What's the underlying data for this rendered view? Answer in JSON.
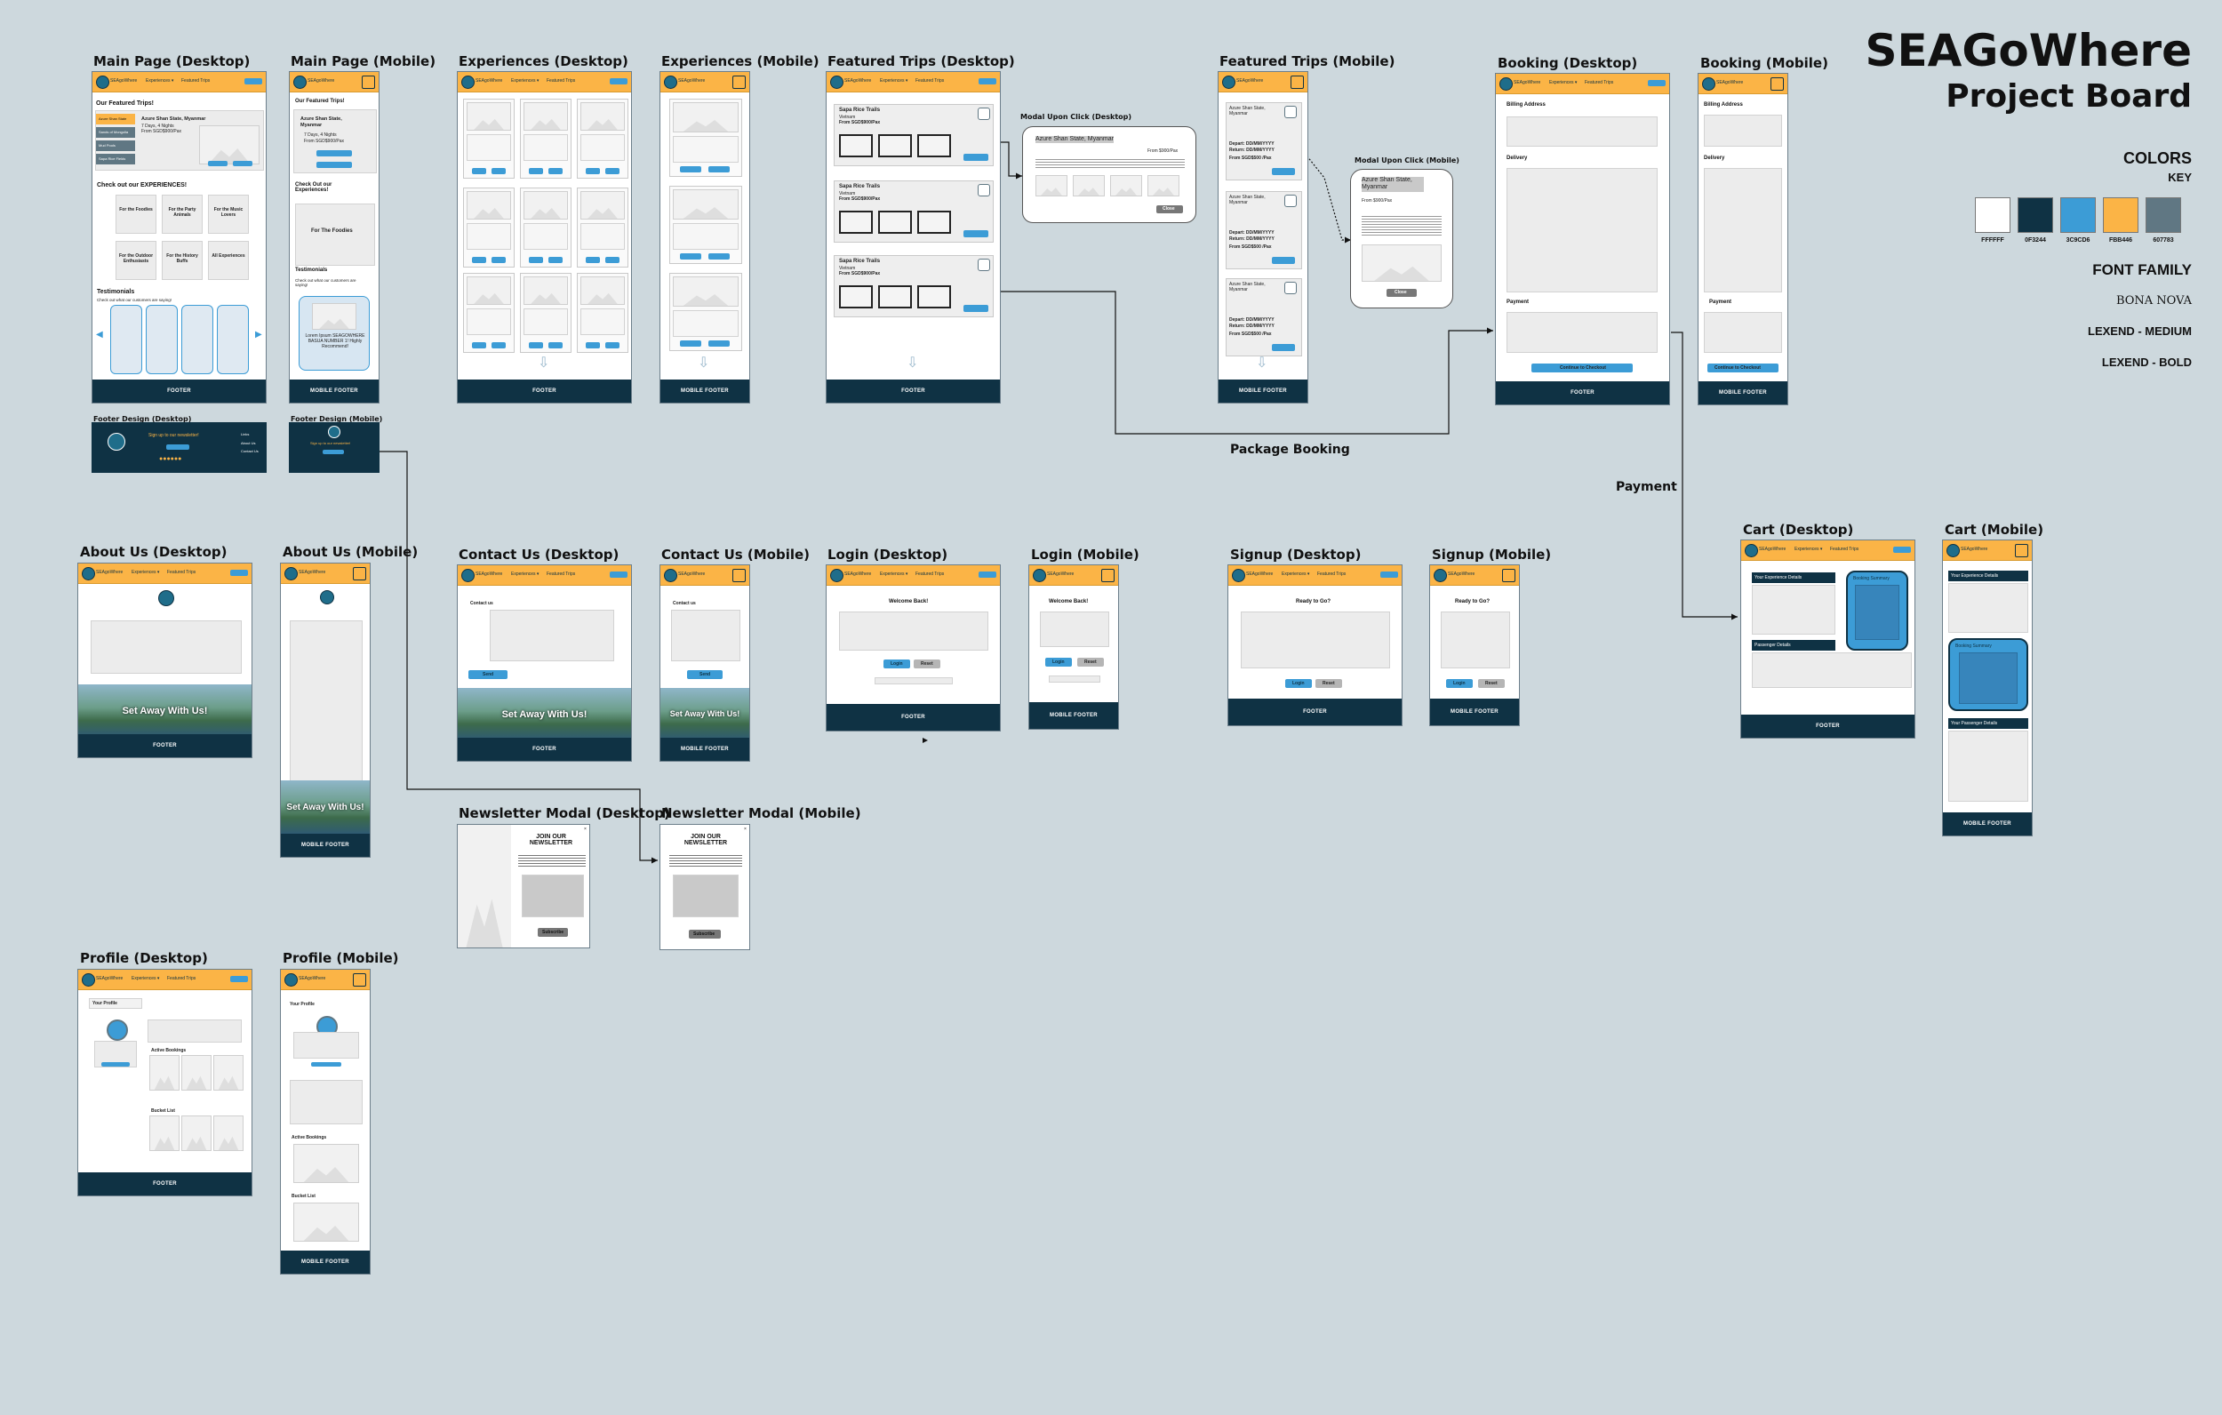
{
  "board": {
    "title": "SEAGoWhere",
    "subtitle": "Project Board",
    "colors_heading": "COLORS",
    "key_label": "KEY",
    "colors": [
      {
        "hex": "#FFFFFF",
        "label": "FFFFFF"
      },
      {
        "hex": "#0F3244",
        "label": "0F3244"
      },
      {
        "hex": "#3C9CD6",
        "label": "3C9CD6"
      },
      {
        "hex": "#FBB446",
        "label": "FBB446"
      },
      {
        "hex": "#607783",
        "label": "607783"
      }
    ],
    "font_heading": "FONT FAMILY",
    "fonts": [
      "BONA NOVA",
      "LEXEND - MEDIUM",
      "LEXEND - BOLD"
    ]
  },
  "flow_labels": {
    "package_booking": "Package Booking",
    "payment": "Payment"
  },
  "titles": {
    "main_desktop": "Main Page (Desktop)",
    "main_mobile": "Main Page (Mobile)",
    "exp_desktop": "Experiences (Desktop)",
    "exp_mobile": "Experiences (Mobile)",
    "feat_desktop": "Featured Trips (Desktop)",
    "feat_mobile": "Featured Trips (Mobile)",
    "booking_desktop": "Booking (Desktop)",
    "booking_mobile": "Booking (Mobile)",
    "footer_desktop": "Footer Design (Desktop)",
    "footer_mobile": "Footer Design (Mobile)",
    "about_desktop": "About Us (Desktop)",
    "about_mobile": "About Us (Mobile)",
    "contact_desktop": "Contact Us (Desktop)",
    "contact_mobile": "Contact Us (Mobile)",
    "login_desktop": "Login (Desktop)",
    "login_mobile": "Login (Mobile)",
    "signup_desktop": "Signup (Desktop)",
    "signup_mobile": "Signup (Mobile)",
    "cart_desktop": "Cart (Desktop)",
    "cart_mobile": "Cart (Mobile)",
    "newsletter_desktop": "Newsletter Modal (Desktop)",
    "newsletter_mobile": "Newsletter Modal (Mobile)",
    "profile_desktop": "Profile (Desktop)",
    "profile_mobile": "Profile (Mobile)",
    "modal_desktop": "Modal Upon Click (Desktop)",
    "modal_mobile": "Modal Upon Click (Mobile)"
  },
  "header": {
    "brand": "SEAgoWhere",
    "nav_experiences": "Experiences ▾",
    "nav_featured": "Featured Trips"
  },
  "footer": {
    "desktop": "FOOTER",
    "mobile": "MOBILE FOOTER"
  },
  "main": {
    "featured_heading": "Our Featured Trips!",
    "trip_name": "Azure Shan State, Myanmar",
    "trip_name_mobile": "Azure Shan State, Myanmar",
    "trip_meta": "7 Days, 4 Nights",
    "trip_price": "From SGD$900/Pax",
    "side_tabs": [
      "Azure Shan State",
      "Sands of Mongolia",
      "Mud Pools",
      "Sapa Rice Fields"
    ],
    "experiences_heading": "Check out our EXPERIENCES!",
    "experiences_heading_mobile": "Check Out our Experiences!",
    "tiles": [
      "For the Foodies",
      "For the Party Animals",
      "For the Music Lovers",
      "For the Outdoor Enthusiasts",
      "For the History Buffs",
      "All Experiences"
    ],
    "mobile_tile": "For The Foodies",
    "testimonials": "Testimonials",
    "testimonials_sub": "Check out what our customers are saying!",
    "mobile_testimonial": "Lorem Ipsum SEAGOWHERE BASUA NUMBER 1! Highly Recommend!"
  },
  "footer_design": {
    "newsletter": "Sign up to our newsletter!",
    "subscribe": "Subscribe"
  },
  "featured": {
    "trip": "Sapa Rice Trails",
    "meta": "Vietnam",
    "price": "From SGD$900/Pax",
    "lets_go": "LET'S GO",
    "modal_title": "Azure Shan State, Myanmar",
    "modal_price": "From $900/Pax",
    "close": "Close",
    "mobile_trip": "Azure Shan State, Myanmar",
    "mobile_depart": "Depart: DD/MM/YYYY",
    "mobile_return": "Return: DD/MM/YYYY",
    "mobile_price": "From SGD$500 /Pax"
  },
  "booking": {
    "billing": "Billing Address",
    "delivery": "Delivery",
    "payment": "Payment",
    "checkout": "Continue to Checkout"
  },
  "contact": {
    "heading": "Contact us",
    "send": "Send"
  },
  "about": {
    "tagline": "Set Away With Us!"
  },
  "login": {
    "welcome": "Welcome Back!",
    "login": "Login",
    "reset": "Reset"
  },
  "signup": {
    "ready": "Ready to Go?",
    "login": "Login",
    "reset": "Reset"
  },
  "cart": {
    "exp_details": "Your Experience Details",
    "passenger": "Passenger Details",
    "summary": "Booking Summary",
    "passenger_mobile": "Your Passenger Details"
  },
  "newsletter": {
    "heading": "JOIN OUR NEWSLETTER",
    "subscribe": "Subscribe"
  },
  "profile": {
    "heading": "Your Profile",
    "active": "Active Bookings",
    "bucket": "Bucket List"
  }
}
